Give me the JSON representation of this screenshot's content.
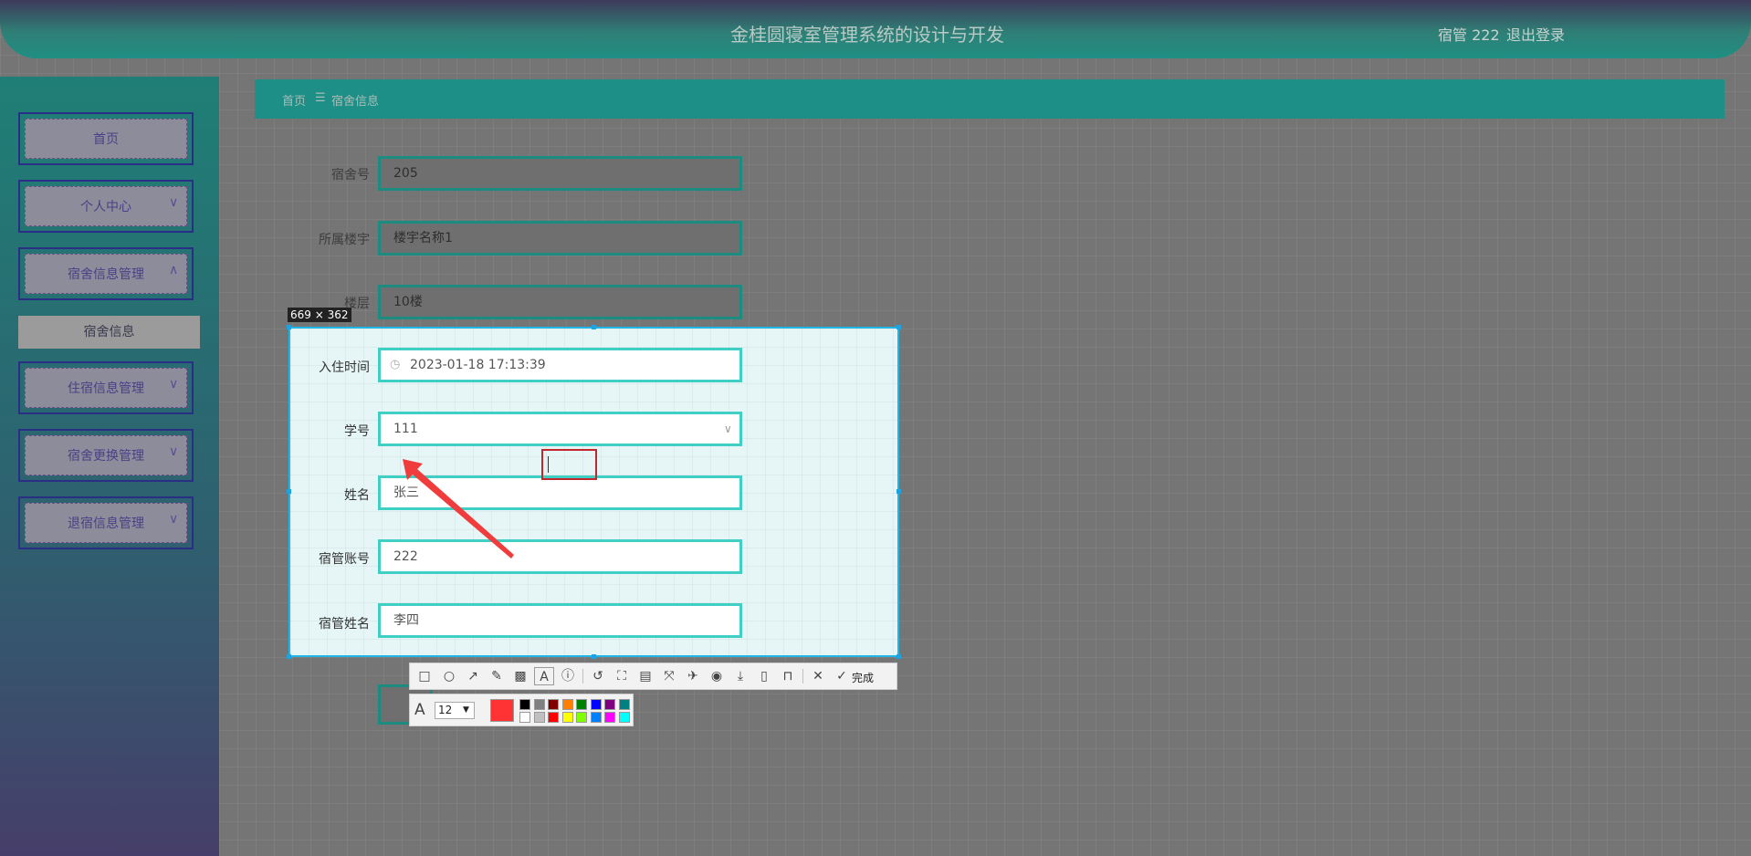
{
  "header": {
    "title": "金桂圆寝室管理系统的设计与开发",
    "user": "宿管 222",
    "logout": "退出登录"
  },
  "sidebar": {
    "items": [
      {
        "label": "首页",
        "chevron": ""
      },
      {
        "label": "个人中心",
        "chevron": "∨"
      },
      {
        "label": "宿舍信息管理",
        "chevron": "∧"
      },
      {
        "label": "住宿信息管理",
        "chevron": "∨"
      },
      {
        "label": "宿舍更换管理",
        "chevron": "∨"
      },
      {
        "label": "退宿信息管理",
        "chevron": "∨"
      }
    ],
    "submenu": "宿舍信息"
  },
  "breadcrumb": {
    "home": "首页",
    "sep": "☰",
    "current": "宿舍信息"
  },
  "form": {
    "fields": [
      {
        "label": "宿舍号",
        "value": "205"
      },
      {
        "label": "所属楼宇",
        "value": "楼宇名称1"
      },
      {
        "label": "楼层",
        "value": "10楼"
      },
      {
        "label": "入住时间",
        "value": "2023-01-18 17:13:39"
      },
      {
        "label": "学号",
        "value": "111"
      },
      {
        "label": "姓名",
        "value": "张三"
      },
      {
        "label": "宿管账号",
        "value": "222"
      },
      {
        "label": "宿管姓名",
        "value": "李四"
      }
    ]
  },
  "screenshot_tool": {
    "size_label": "669 × 362",
    "done_label": "完成",
    "font_size": "12",
    "font_icon": "A",
    "tools": [
      "rect-icon",
      "ellipse-icon",
      "arrow-icon",
      "pencil-icon",
      "mosaic-icon",
      "text-icon",
      "number-icon",
      "undo-icon",
      "ocr-icon",
      "translate-icon",
      "scroll-capture-icon",
      "pin-icon",
      "record-icon",
      "save-icon",
      "phone-icon",
      "bookmark-icon",
      "cancel-icon",
      "done-icon"
    ],
    "active_color": "#ff3333",
    "palette": [
      "#000000",
      "#808080",
      "#800000",
      "#ff8000",
      "#008000",
      "#0000ff",
      "#800080",
      "#008080",
      "#ffffff",
      "#c0c0c0",
      "#ff0000",
      "#ffff00",
      "#80ff00",
      "#0080ff",
      "#ff00ff",
      "#00ffff"
    ]
  }
}
